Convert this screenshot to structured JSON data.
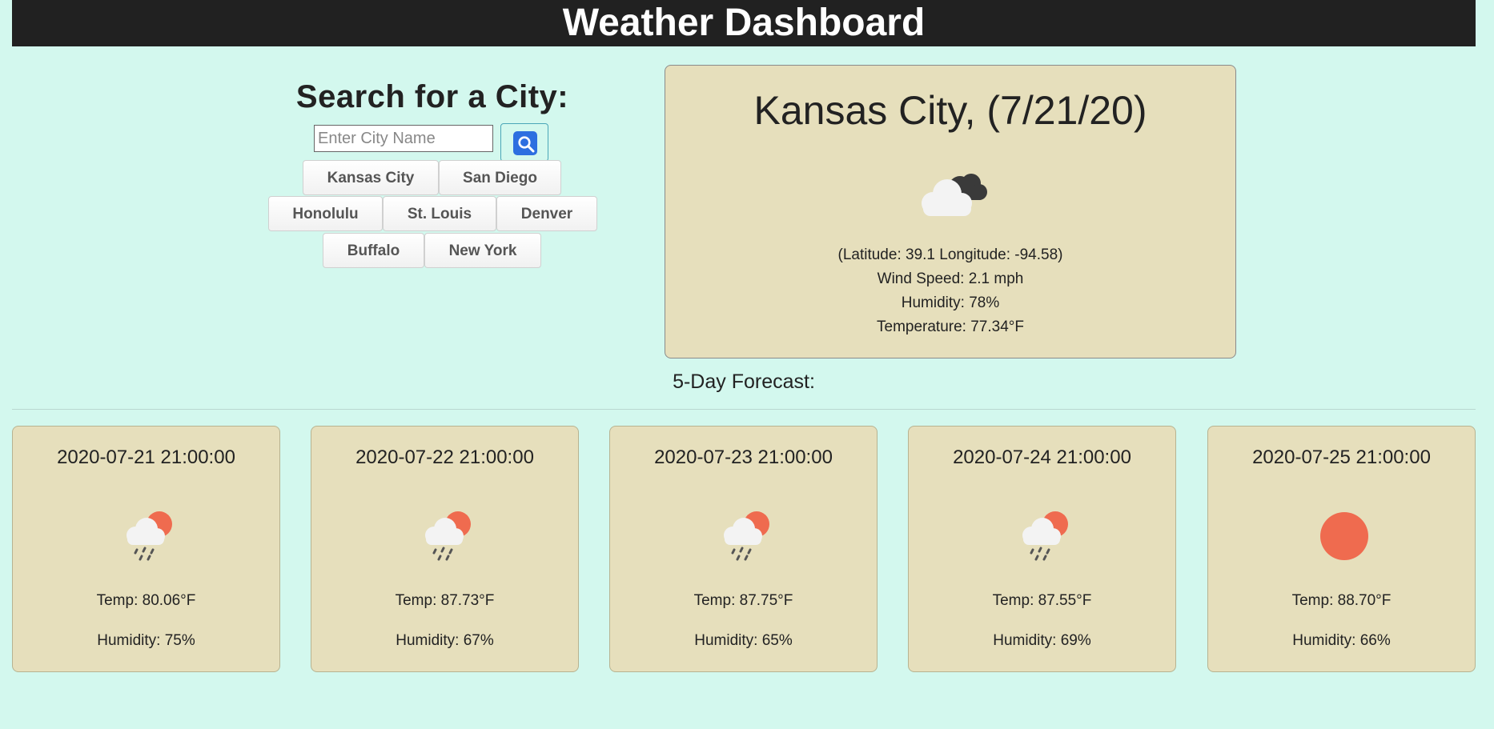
{
  "header": {
    "title": "Weather Dashboard"
  },
  "search": {
    "title": "Search for a City:",
    "placeholder": "Enter City Name",
    "icon": "search-icon",
    "button_color": "#2d6fe0",
    "history": [
      "Kansas City",
      "San Diego",
      "Honolulu",
      "St. Louis",
      "Denver",
      "Buffalo",
      "New York"
    ]
  },
  "current": {
    "title": "Kansas City, (7/21/20)",
    "icon": "partly-cloudy-night-icon",
    "coords": "(Latitude: 39.1 Longitude: -94.58)",
    "wind": "Wind Speed: 2.1 mph",
    "humidity": "Humidity: 78%",
    "temperature": "Temperature: 77.34°F"
  },
  "forecast": {
    "heading": "5-Day Forecast:",
    "days": [
      {
        "date": "2020-07-21 21:00:00",
        "icon": "rain-sun-icon",
        "temp": "Temp: 80.06°F",
        "humidity": "Humidity: 75%"
      },
      {
        "date": "2020-07-22 21:00:00",
        "icon": "rain-sun-icon",
        "temp": "Temp: 87.73°F",
        "humidity": "Humidity: 67%"
      },
      {
        "date": "2020-07-23 21:00:00",
        "icon": "rain-sun-icon",
        "temp": "Temp: 87.75°F",
        "humidity": "Humidity: 65%"
      },
      {
        "date": "2020-07-24 21:00:00",
        "icon": "rain-sun-icon",
        "temp": "Temp: 87.55°F",
        "humidity": "Humidity: 69%"
      },
      {
        "date": "2020-07-25 21:00:00",
        "icon": "sun-icon",
        "temp": "Temp: 88.70°F",
        "humidity": "Humidity: 66%"
      }
    ]
  },
  "colors": {
    "background": "#d3f8ee",
    "header": "#212121",
    "card": "#e6dfbc",
    "sun": "#ef6b4f"
  }
}
